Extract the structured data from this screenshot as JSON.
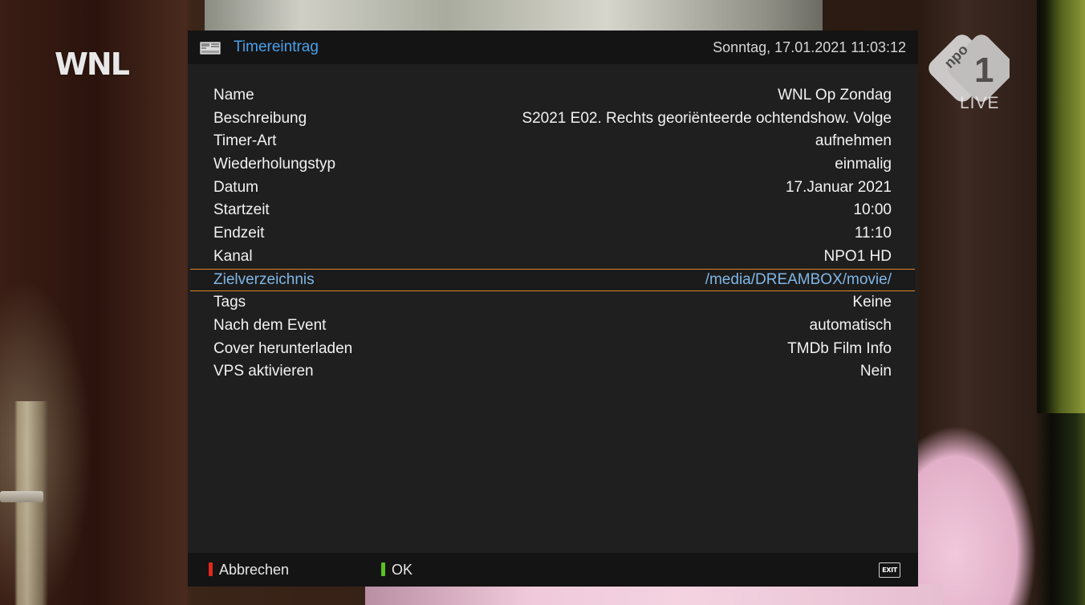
{
  "channel_logo_left": "WNL",
  "channel_logo_right": {
    "brand": "npo",
    "number": "1",
    "live_label": "LIVE"
  },
  "dialog": {
    "title": "Timereintrag",
    "header_icon": "timer-entry-icon",
    "datetime": "Sonntag, 17.01.2021  11:03:12",
    "rows": [
      {
        "label": "Name",
        "value": "WNL Op Zondag"
      },
      {
        "label": "Beschreibung",
        "value": "S2021 E02. Rechts georiënteerde ochtendshow. Volge"
      },
      {
        "label": "Timer-Art",
        "value": "aufnehmen"
      },
      {
        "label": "Wiederholungstyp",
        "value": "einmalig"
      },
      {
        "label": "Datum",
        "value": "17.Januar 2021"
      },
      {
        "label": "Startzeit",
        "value": "10:00"
      },
      {
        "label": "Endzeit",
        "value": "11:10"
      },
      {
        "label": "Kanal",
        "value": "NPO1 HD"
      },
      {
        "label": "Zielverzeichnis",
        "value": "/media/DREAMBOX/movie/",
        "selected": true
      },
      {
        "label": "Tags",
        "value": "Keine"
      },
      {
        "label": "Nach dem Event",
        "value": "automatisch"
      },
      {
        "label": "Cover herunterladen",
        "value": "TMDb Film Info"
      },
      {
        "label": "VPS aktivieren",
        "value": "Nein"
      }
    ],
    "footer": {
      "red_key": {
        "label": "Abbrechen",
        "color": "#e0281e"
      },
      "green_key": {
        "label": "OK",
        "color": "#5cc21e"
      },
      "exit_key": {
        "label": "EXIT"
      }
    }
  },
  "colors": {
    "title": "#4aa0ea",
    "selection_border": "#e08a28",
    "selected_text": "#7fb6e6"
  }
}
